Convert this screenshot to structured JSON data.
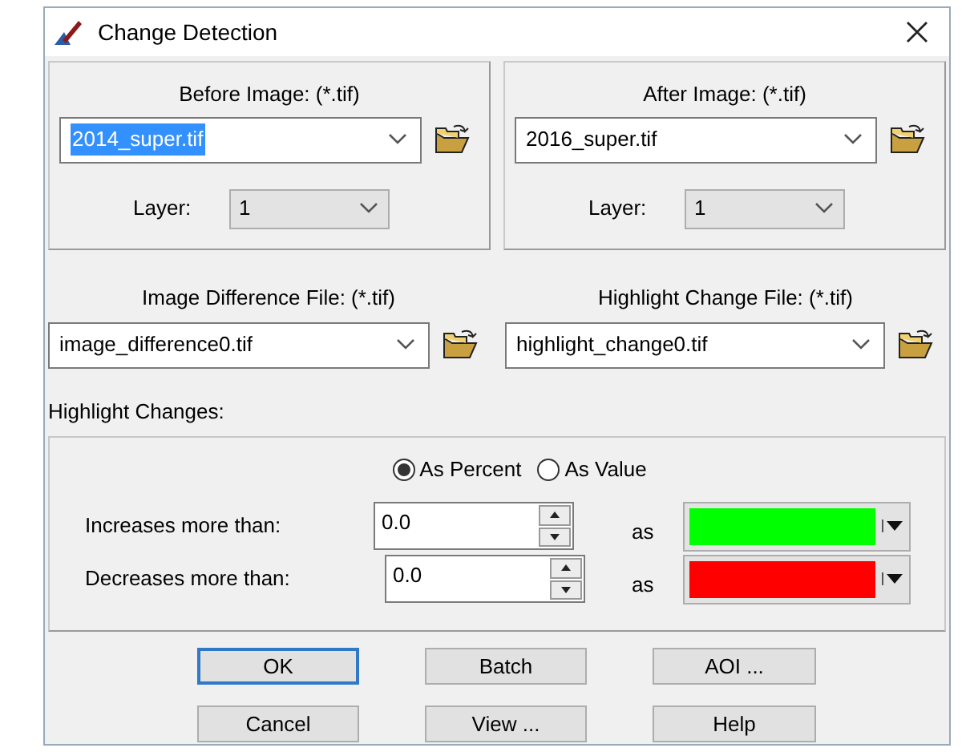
{
  "window": {
    "title": "Change Detection"
  },
  "image_panels": [
    {
      "label": "Before Image: (*.tif)",
      "file": "2014_super.tif",
      "file_text_selected": true,
      "layer_label": "Layer:",
      "layer": "1"
    },
    {
      "label": "After Image: (*.tif)",
      "file": "2016_super.tif",
      "file_text_selected": false,
      "layer_label": "Layer:",
      "layer": "1"
    }
  ],
  "output_files": [
    {
      "label": "Image Difference File: (*.tif)",
      "file": "image_difference0.tif"
    },
    {
      "label": "Highlight Change File: (*.tif)",
      "file": "highlight_change0.tif"
    }
  ],
  "highlight_changes": {
    "label": "Highlight Changes:",
    "modes": [
      {
        "label": "As Percent",
        "selected": true
      },
      {
        "label": "As Value",
        "selected": false
      }
    ],
    "thresholds": [
      {
        "label": "Increases more than:",
        "value": "0.0",
        "as_label": "as",
        "color": "#00ff00"
      },
      {
        "label": "Decreases more than:",
        "value": "0.0",
        "as_label": "as",
        "color": "#ff0000"
      }
    ]
  },
  "buttons": [
    {
      "label": "OK",
      "default": true
    },
    {
      "label": "Batch",
      "default": false
    },
    {
      "label": "AOI ...",
      "default": false
    },
    {
      "label": "Cancel",
      "default": false
    },
    {
      "label": "View ...",
      "default": false
    },
    {
      "label": "Help",
      "default": false
    }
  ]
}
